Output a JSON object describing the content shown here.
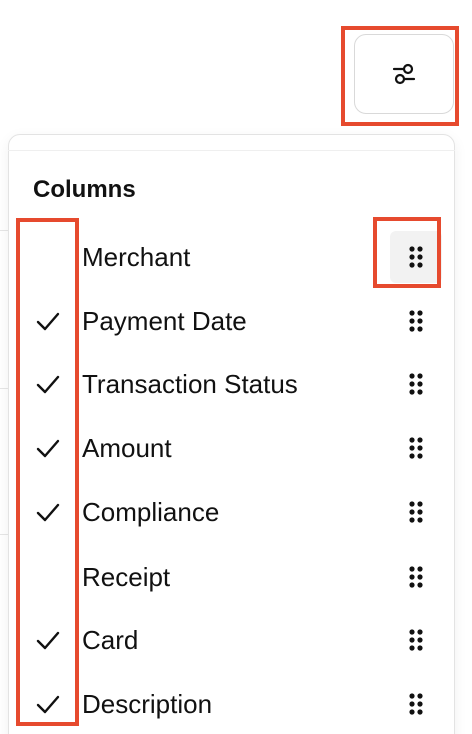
{
  "toolbar": {
    "filter_icon": "sliders-icon"
  },
  "columns_panel": {
    "title": "Columns",
    "items": [
      {
        "label": "Merchant",
        "checked": false
      },
      {
        "label": "Payment Date",
        "checked": true
      },
      {
        "label": "Transaction Status",
        "checked": true
      },
      {
        "label": "Amount",
        "checked": true
      },
      {
        "label": "Compliance",
        "checked": true
      },
      {
        "label": "Receipt",
        "checked": false
      },
      {
        "label": "Card",
        "checked": true
      },
      {
        "label": "Description",
        "checked": true
      }
    ]
  },
  "colors": {
    "highlight": "#e64a2e",
    "handle_active_bg": "#f2f2f2"
  }
}
